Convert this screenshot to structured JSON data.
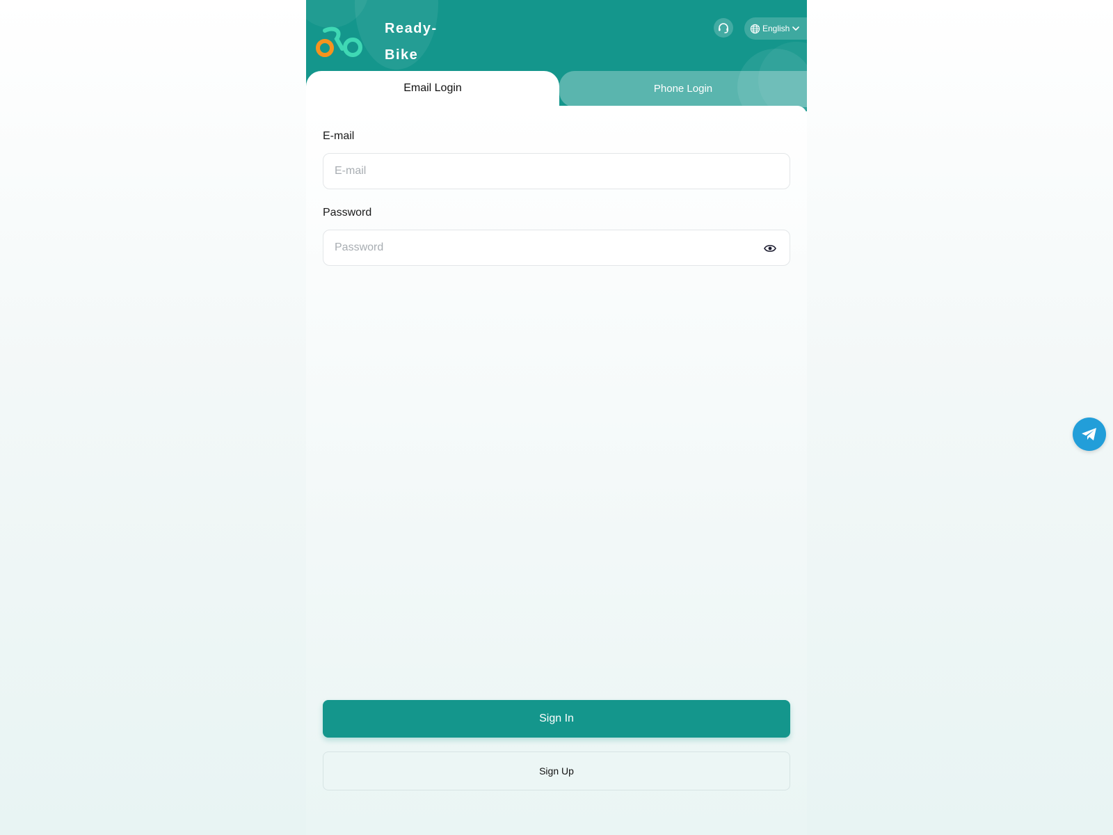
{
  "header": {
    "brand_line1": "Ready-",
    "brand_line2": "Bike",
    "support_icon": "headset-icon",
    "language": {
      "icon": "globe-icon",
      "selected": "English",
      "chevron_icon": "chevron-down-icon"
    }
  },
  "tabs": [
    {
      "label": "Email Login",
      "active": true
    },
    {
      "label": "Phone Login",
      "active": false
    }
  ],
  "form": {
    "email": {
      "label": "E-mail",
      "placeholder": "E-mail",
      "value": ""
    },
    "password": {
      "label": "Password",
      "placeholder": "Password",
      "value": "",
      "toggle_icon": "eye-icon"
    }
  },
  "actions": {
    "sign_in": "Sign In",
    "sign_up": "Sign Up"
  },
  "floating": {
    "icon": "telegram-icon"
  },
  "colors": {
    "brand": "#14968c",
    "logo_orange": "#f7931e",
    "logo_mint": "#3fd8b4",
    "telegram": "#229ed9"
  }
}
